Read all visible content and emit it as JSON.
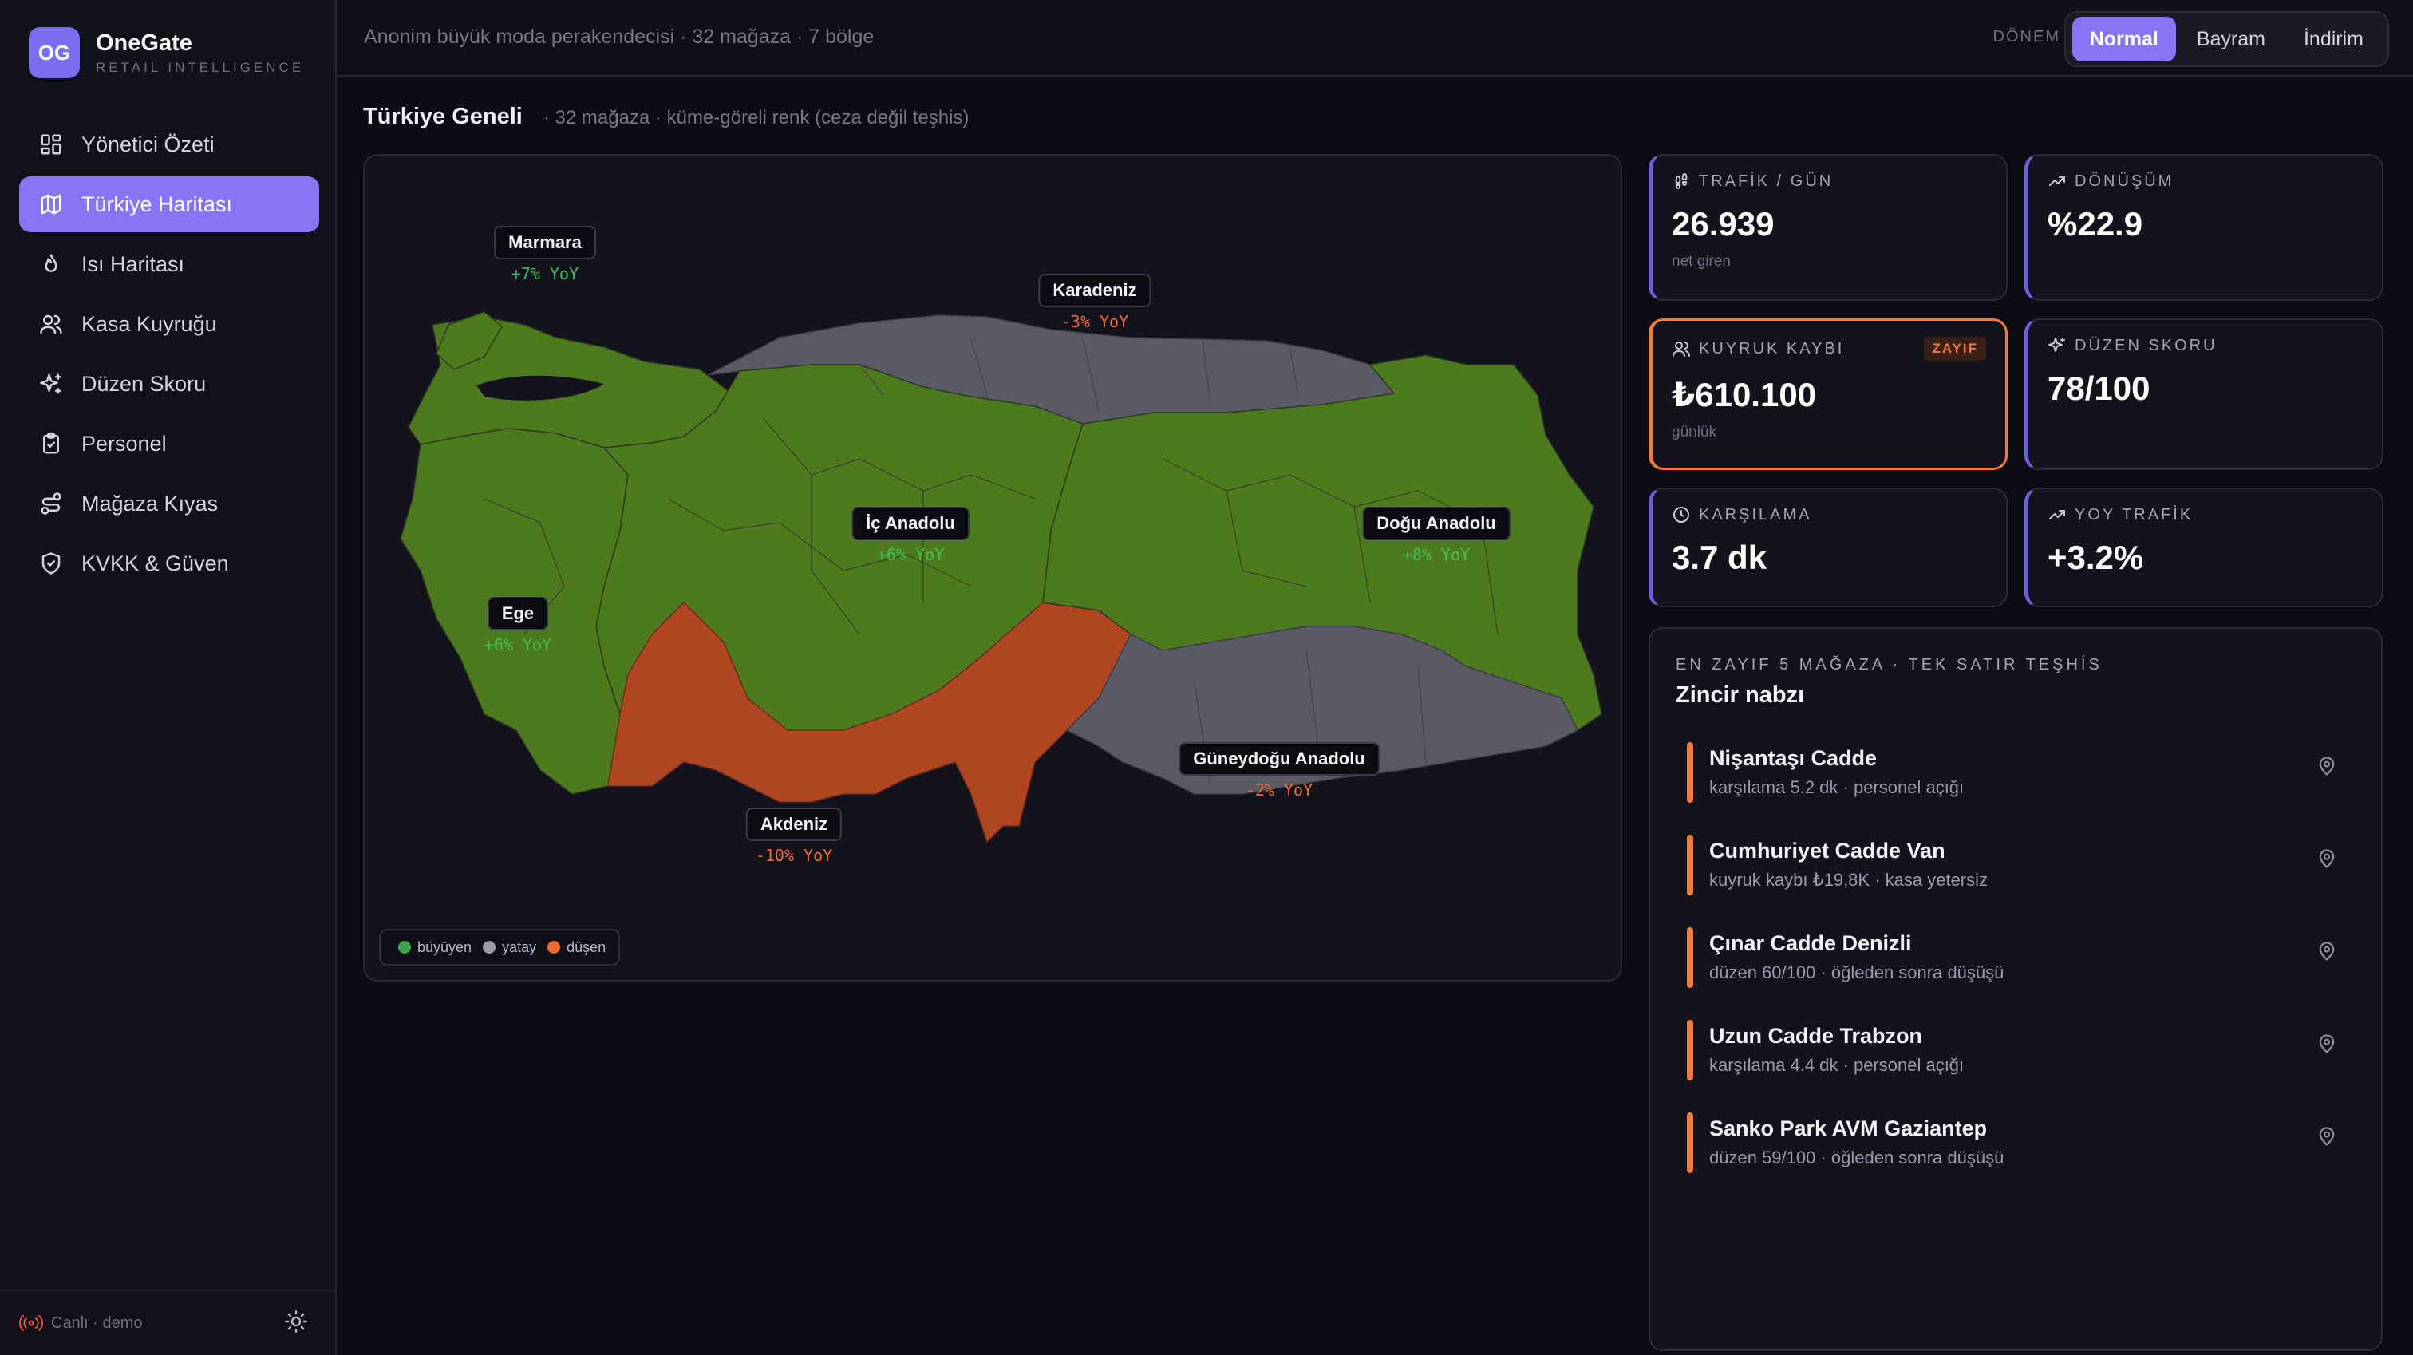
{
  "brand": {
    "initials": "OG",
    "name": "OneGate",
    "subtitle": "RETAIL INTELLIGENCE"
  },
  "nav": [
    {
      "label": "Yönetici Özeti",
      "icon": "grid-icon",
      "active": false
    },
    {
      "label": "Türkiye Haritası",
      "icon": "map-icon",
      "active": true
    },
    {
      "label": "Isı Haritası",
      "icon": "flame-icon",
      "active": false
    },
    {
      "label": "Kasa Kuyruğu",
      "icon": "users-icon",
      "active": false
    },
    {
      "label": "Düzen Skoru",
      "icon": "sparkles-icon",
      "active": false
    },
    {
      "label": "Personel",
      "icon": "clipboard-icon",
      "active": false
    },
    {
      "label": "Mağaza Kıyas",
      "icon": "route-icon",
      "active": false
    },
    {
      "label": "KVKK & Güven",
      "icon": "shield-check-icon",
      "active": false
    }
  ],
  "footer": {
    "status": "Canlı · demo"
  },
  "topbar": {
    "subtitle": "Anonim büyük moda perakendecisi · 32 mağaza · 7 bölge",
    "period_label": "DÖNEM",
    "periods": [
      {
        "label": "Normal",
        "active": true
      },
      {
        "label": "Bayram",
        "active": false
      },
      {
        "label": "İndirim",
        "active": false
      }
    ]
  },
  "section": {
    "title": "Türkiye Geneli",
    "subtitle": "· 32 mağaza · küme-göreli renk (ceza değil teşhis)"
  },
  "map": {
    "colors": {
      "growing": "#4e7a1e",
      "flat": "#5a5a64",
      "declining": "#b04522"
    },
    "regions": [
      {
        "name": "Marmara",
        "yoy": "+7% YoY",
        "trend": "up"
      },
      {
        "name": "Karadeniz",
        "yoy": "-3% YoY",
        "trend": "down"
      },
      {
        "name": "İç Anadolu",
        "yoy": "+6% YoY",
        "trend": "up"
      },
      {
        "name": "Doğu Anadolu",
        "yoy": "+8% YoY",
        "trend": "up"
      },
      {
        "name": "Ege",
        "yoy": "+6% YoY",
        "trend": "up"
      },
      {
        "name": "Güneydoğu Anadolu",
        "yoy": "-2% YoY",
        "trend": "down"
      },
      {
        "name": "Akdeniz",
        "yoy": "-10% YoY",
        "trend": "down"
      }
    ],
    "legend": [
      {
        "label": "büyüyen",
        "color": "#3fa34d"
      },
      {
        "label": "yatay",
        "color": "#9a9aa8"
      },
      {
        "label": "düşen",
        "color": "#f06a2c"
      }
    ]
  },
  "kpis": [
    {
      "label": "TRAFİK / GÜN",
      "icon": "footprints-icon",
      "value": "26.939",
      "sub": "net giren",
      "badge": ""
    },
    {
      "label": "DÖNÜŞÜM",
      "icon": "trending-up-icon",
      "value": "%22.9",
      "sub": "",
      "badge": ""
    },
    {
      "label": "KUYRUK KAYBI",
      "icon": "users-icon",
      "value": "₺610.100",
      "sub": "günlük",
      "badge": "ZAYIF"
    },
    {
      "label": "DÜZEN SKORU",
      "icon": "sparkles-icon",
      "value": "78/100",
      "sub": "",
      "badge": ""
    },
    {
      "label": "KARŞILAMA",
      "icon": "clock-icon",
      "value": "3.7 dk",
      "sub": "",
      "badge": ""
    },
    {
      "label": "YOY TRAFİK",
      "icon": "trending-up-icon",
      "value": "+3.2%",
      "sub": "",
      "badge": ""
    }
  ],
  "weakest": {
    "eyebrow": "EN ZAYIF 5 MAĞAZA · TEK SATIR TEŞHİS",
    "title": "Zincir nabzı",
    "items": [
      {
        "name": "Nişantaşı Cadde",
        "meta": "karşılama 5.2 dk · personel açığı"
      },
      {
        "name": "Cumhuriyet Cadde Van",
        "meta": "kuyruk kaybı ₺19,8K · kasa yetersiz"
      },
      {
        "name": "Çınar Cadde Denizli",
        "meta": "düzen 60/100 · öğleden sonra düşüşü"
      },
      {
        "name": "Uzun Cadde Trabzon",
        "meta": "karşılama 4.4 dk · personel açığı"
      },
      {
        "name": "Sanko Park AVM Gaziantep",
        "meta": "düzen 59/100 · öğleden sonra düşüşü"
      }
    ]
  }
}
